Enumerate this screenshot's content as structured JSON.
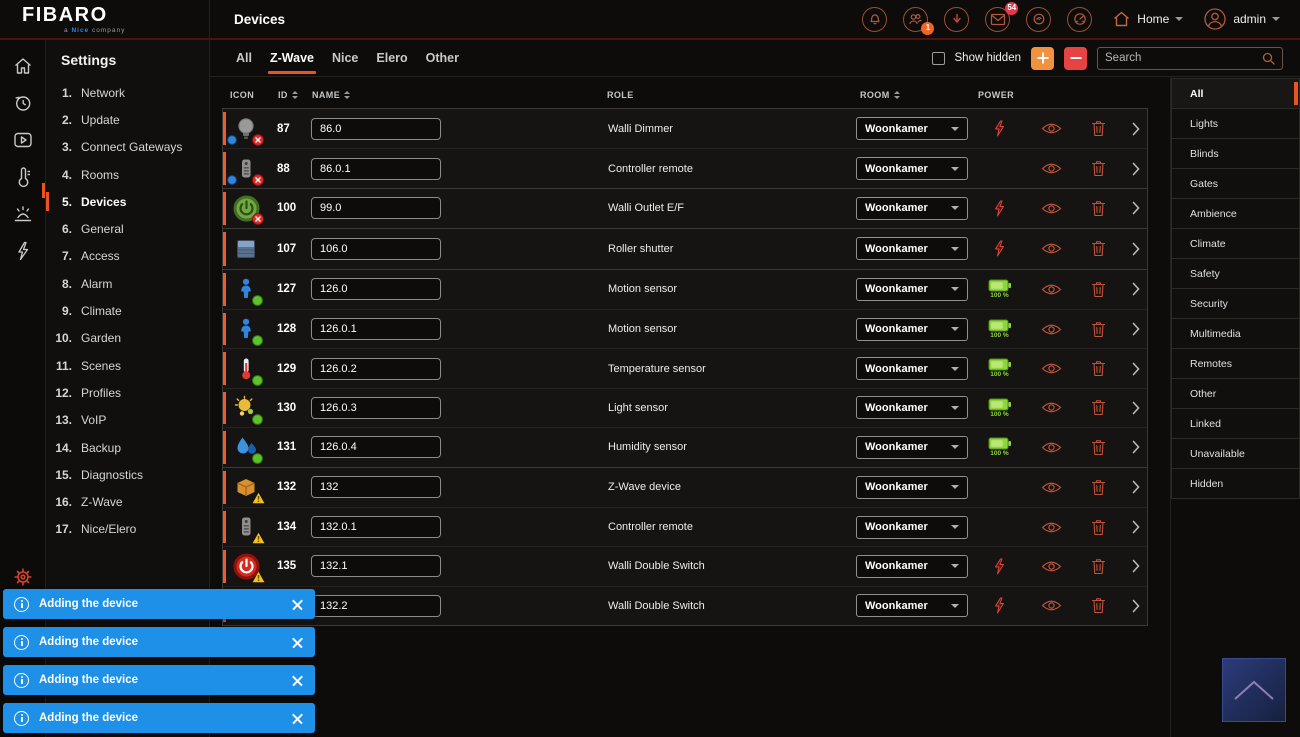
{
  "brand": {
    "name": "FIBARO",
    "tagline": {
      "prefix": "a",
      "brand": "Nice",
      "suffix": "company"
    }
  },
  "topbar": {
    "title": "Devices",
    "icons": [
      {
        "name": "alarm"
      },
      {
        "name": "users",
        "badge": "1",
        "badge_style": "orange",
        "badge_pos": "br"
      },
      {
        "name": "voip"
      },
      {
        "name": "messages",
        "badge": "54",
        "badge_style": "red",
        "badge_pos": "tr"
      },
      {
        "name": "intercom"
      },
      {
        "name": "meter"
      }
    ],
    "home_label": "Home",
    "user_label": "admin"
  },
  "rail": {
    "icons": [
      {
        "name": "home"
      },
      {
        "name": "history"
      },
      {
        "name": "media"
      },
      {
        "name": "climate"
      },
      {
        "name": "garden"
      },
      {
        "name": "power"
      }
    ]
  },
  "settings": {
    "title": "Settings",
    "items": [
      {
        "num": "1.",
        "label": "Network"
      },
      {
        "num": "2.",
        "label": "Update"
      },
      {
        "num": "3.",
        "label": "Connect Gateways"
      },
      {
        "num": "4.",
        "label": "Rooms"
      },
      {
        "num": "5.",
        "label": "Devices",
        "active": true
      },
      {
        "num": "6.",
        "label": "General"
      },
      {
        "num": "7.",
        "label": "Access"
      },
      {
        "num": "8.",
        "label": "Alarm"
      },
      {
        "num": "9.",
        "label": "Climate"
      },
      {
        "num": "10.",
        "label": "Garden"
      },
      {
        "num": "11.",
        "label": "Scenes"
      },
      {
        "num": "12.",
        "label": "Profiles"
      },
      {
        "num": "13.",
        "label": "VoIP"
      },
      {
        "num": "14.",
        "label": "Backup"
      },
      {
        "num": "15.",
        "label": "Diagnostics"
      },
      {
        "num": "16.",
        "label": "Z-Wave"
      },
      {
        "num": "17.",
        "label": "Nice/Elero"
      }
    ]
  },
  "tabs": [
    {
      "label": "All"
    },
    {
      "label": "Z-Wave",
      "active": true
    },
    {
      "label": "Nice"
    },
    {
      "label": "Elero"
    },
    {
      "label": "Other"
    }
  ],
  "controls": {
    "show_hidden": "Show hidden",
    "search_placeholder": "Search"
  },
  "accent_colors": {
    "orange": "#e95420",
    "add_button": "#f0923e",
    "remove_button": "#e84343",
    "toast_blue": "#1e90e8",
    "battery_green": "#8fd53c"
  },
  "table": {
    "columns": [
      {
        "label": "ICON"
      },
      {
        "label": "ID",
        "sortable": true
      },
      {
        "label": "NAME",
        "sortable": true
      },
      {
        "label": "ROLE"
      },
      {
        "label": "ROOM",
        "sortable": true
      },
      {
        "label": "POWER"
      }
    ],
    "groups": [
      {
        "rows": [
          {
            "id": "87",
            "icon": "bulb",
            "badges": [
              "blue-dot",
              "red-x"
            ],
            "name": "86.0",
            "role": "Walli Dimmer",
            "room": "Woonkamer",
            "power": "mains"
          },
          {
            "id": "88",
            "icon": "remote",
            "badges": [
              "blue-dot",
              "red-x"
            ],
            "name": "86.0.1",
            "role": "Controller remote",
            "room": "Woonkamer",
            "power": "none"
          }
        ]
      },
      {
        "rows": [
          {
            "id": "100",
            "icon": "power-green",
            "badges": [
              "red-x"
            ],
            "name": "99.0",
            "role": "Walli Outlet E/F",
            "room": "Woonkamer",
            "power": "mains"
          }
        ]
      },
      {
        "rows": [
          {
            "id": "107",
            "icon": "shutter",
            "badges": [],
            "name": "106.0",
            "role": "Roller shutter",
            "room": "Woonkamer",
            "power": "mains"
          }
        ]
      },
      {
        "rows": [
          {
            "id": "127",
            "icon": "motion",
            "badges": [
              "green-dot"
            ],
            "name": "126.0",
            "role": "Motion sensor",
            "room": "Woonkamer",
            "power": "battery",
            "battery": "100 %"
          },
          {
            "id": "128",
            "icon": "motion",
            "badges": [
              "green-dot"
            ],
            "name": "126.0.1",
            "role": "Motion sensor",
            "room": "Woonkamer",
            "power": "battery",
            "battery": "100 %"
          },
          {
            "id": "129",
            "icon": "thermo",
            "badges": [
              "green-dot"
            ],
            "name": "126.0.2",
            "role": "Temperature sensor",
            "room": "Woonkamer",
            "power": "battery",
            "battery": "100 %"
          },
          {
            "id": "130",
            "icon": "light",
            "badges": [
              "green-dot"
            ],
            "name": "126.0.3",
            "role": "Light sensor",
            "room": "Woonkamer",
            "power": "battery",
            "battery": "100 %"
          },
          {
            "id": "131",
            "icon": "humidity",
            "badges": [
              "green-dot"
            ],
            "name": "126.0.4",
            "role": "Humidity sensor",
            "room": "Woonkamer",
            "power": "battery",
            "battery": "100 %"
          }
        ]
      },
      {
        "rows": [
          {
            "id": "132",
            "icon": "zwave",
            "badges": [
              "warning"
            ],
            "name": "132",
            "role": "Z-Wave device",
            "room": "Woonkamer",
            "power": "none"
          },
          {
            "id": "134",
            "icon": "remote",
            "badges": [
              "warning"
            ],
            "name": "132.0.1",
            "role": "Controller remote",
            "room": "Woonkamer",
            "power": "none"
          },
          {
            "id": "135",
            "icon": "power-red",
            "badges": [
              "warning"
            ],
            "name": "132.1",
            "role": "Walli Double Switch",
            "room": "Woonkamer",
            "power": "mains"
          },
          {
            "id": "",
            "icon": "power-red",
            "badges": [],
            "name": "132.2",
            "role": "Walli Double Switch",
            "room": "Woonkamer",
            "power": "mains"
          }
        ]
      }
    ]
  },
  "categories": [
    {
      "label": "All",
      "active": true
    },
    {
      "label": "Lights"
    },
    {
      "label": "Blinds"
    },
    {
      "label": "Gates"
    },
    {
      "label": "Ambience"
    },
    {
      "label": "Climate"
    },
    {
      "label": "Safety"
    },
    {
      "label": "Security"
    },
    {
      "label": "Multimedia"
    },
    {
      "label": "Remotes"
    },
    {
      "label": "Other"
    },
    {
      "label": "Linked"
    },
    {
      "label": "Unavailable"
    },
    {
      "label": "Hidden"
    }
  ],
  "toasts": [
    {
      "text": "Adding the device"
    },
    {
      "text": "Adding the device"
    },
    {
      "text": "Adding the device"
    },
    {
      "text": "Adding the device"
    }
  ]
}
